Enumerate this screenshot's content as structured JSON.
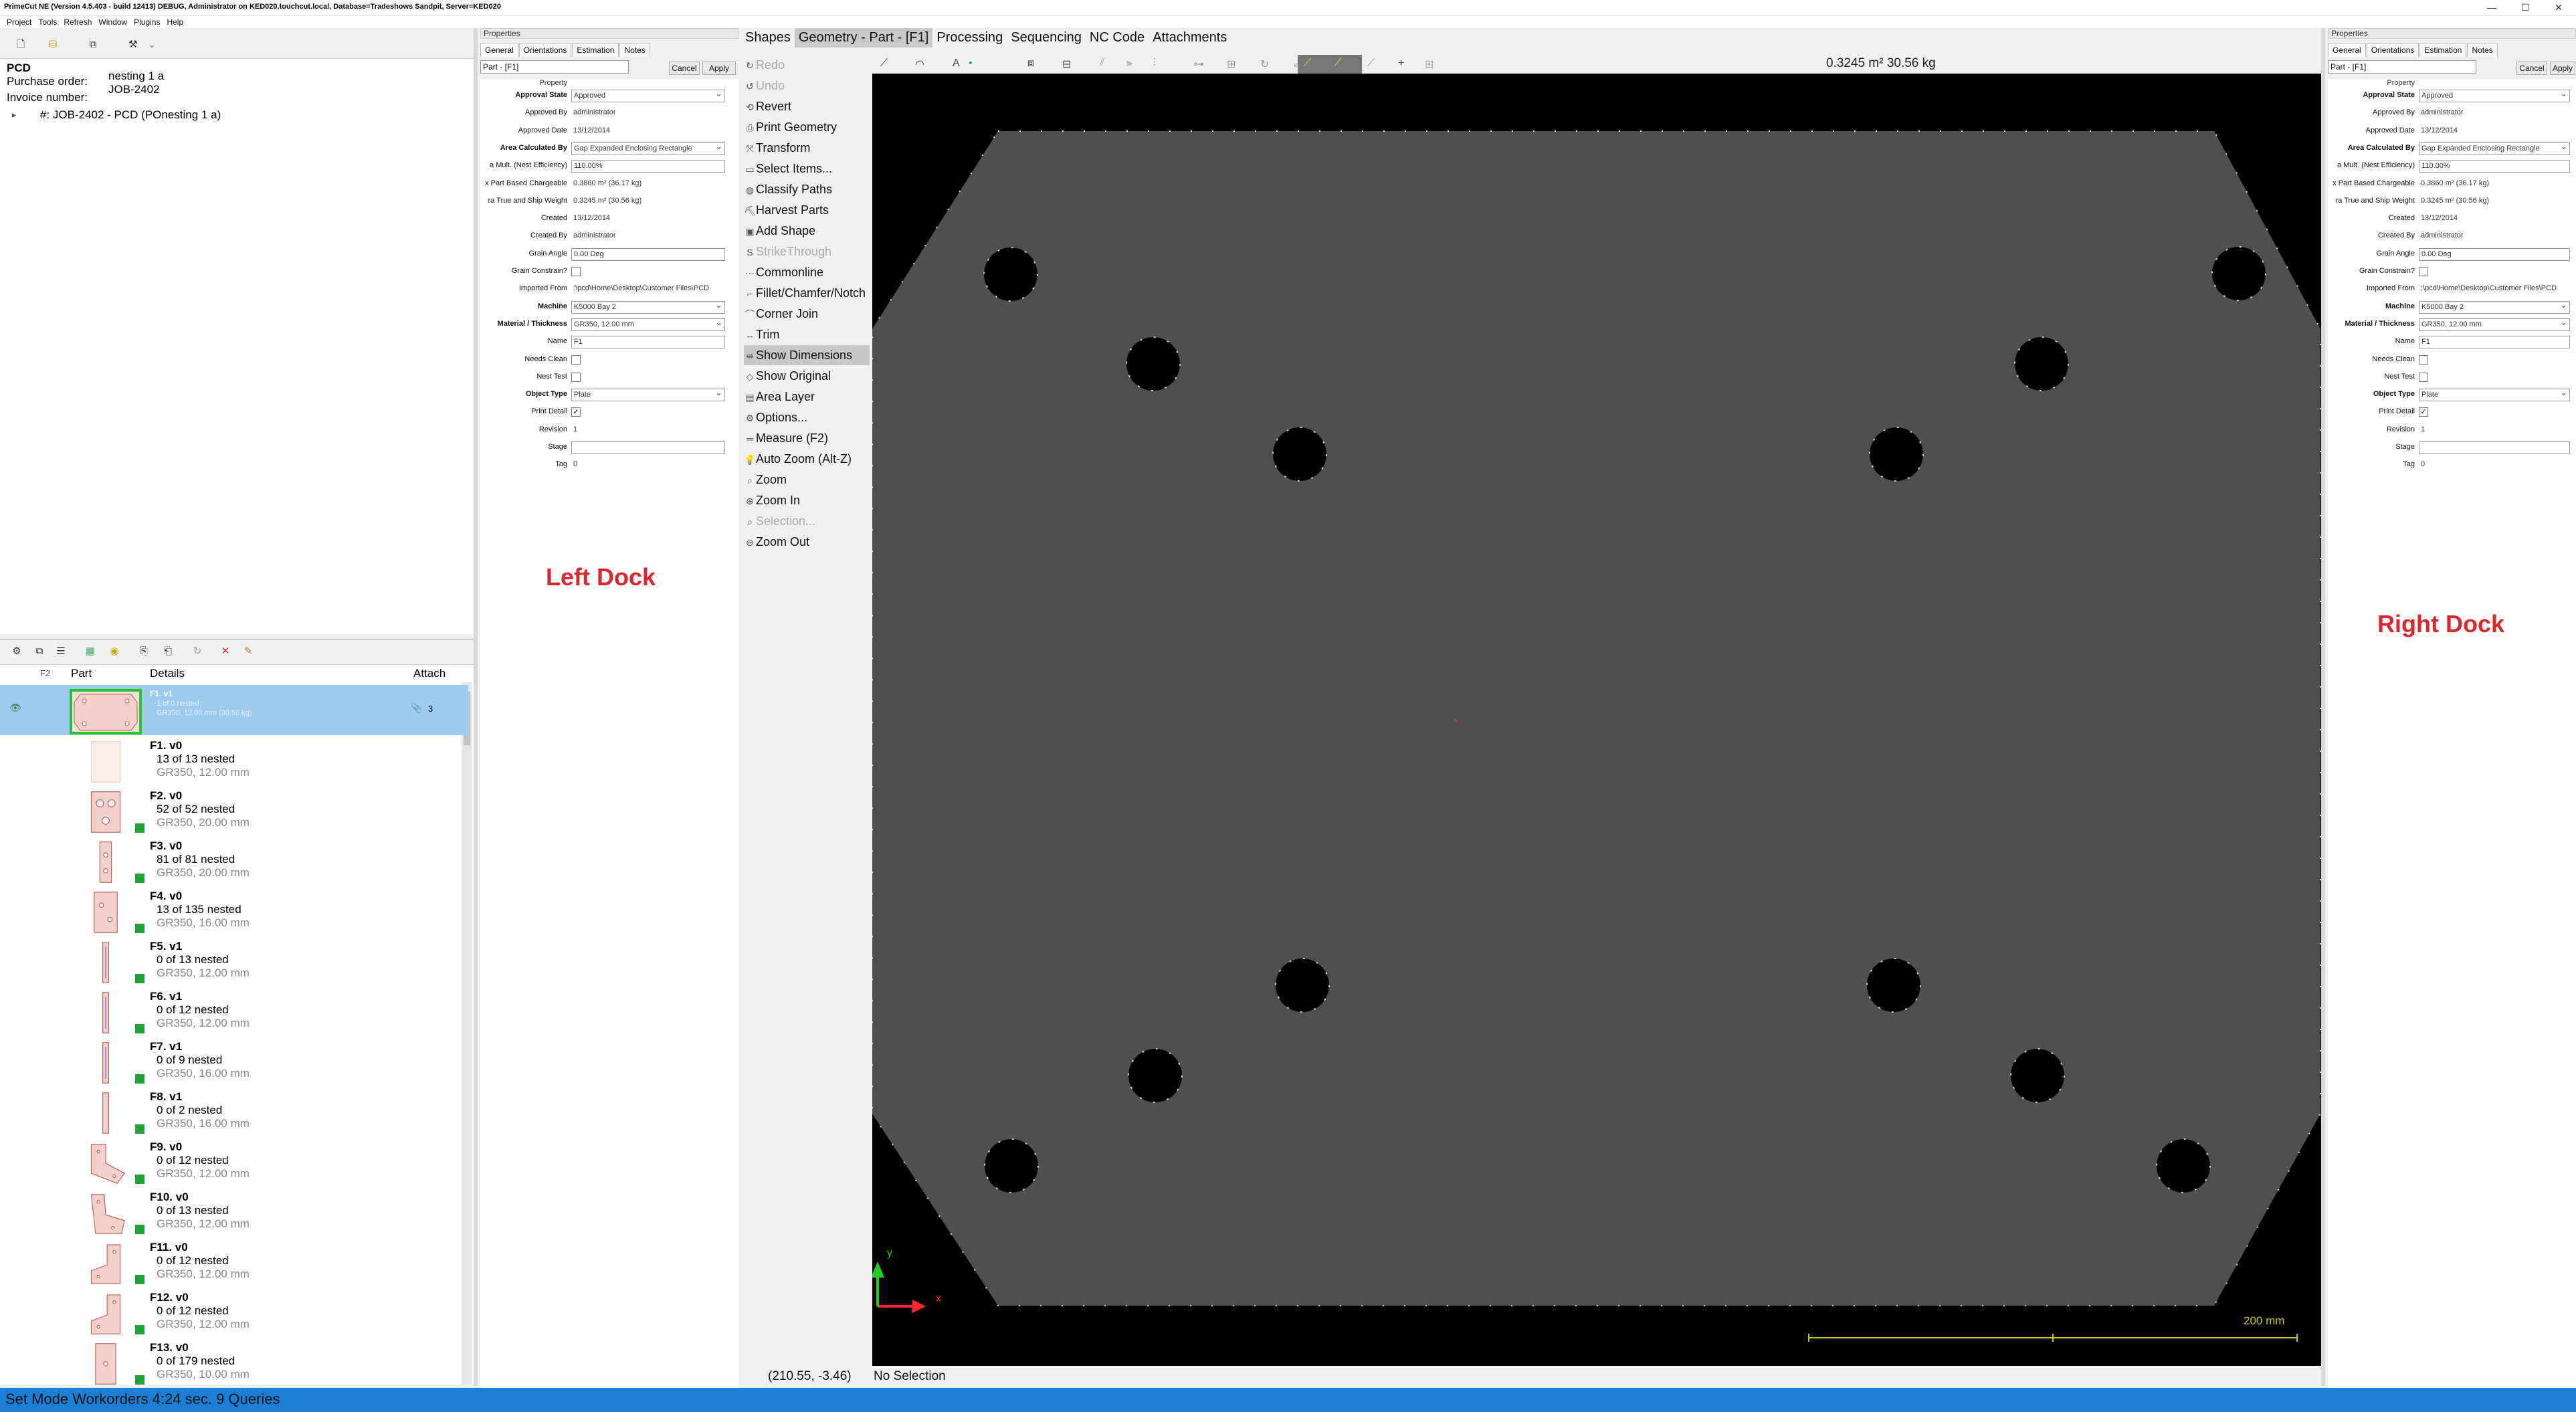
{
  "window": {
    "title": "PrimeCut NE (Version 4.5.403 - build 12413) DEBUG, Administrator on KED020.touchcut.local, Database=Tradeshows Sandpit, Server=KED020",
    "controls": [
      "—",
      "☐",
      "✕"
    ]
  },
  "menu": [
    "Project",
    "Tools",
    "Refresh",
    "Window",
    "Plugins",
    "Help"
  ],
  "job": {
    "customer": "PCD",
    "po_label": "Purchase order:",
    "po_value": "nesting 1 a",
    "invoice_label": "Invoice number:",
    "invoice_value": "JOB-2402",
    "tree_item": "#: JOB-2402 - PCD (POnesting 1 a)"
  },
  "partlist": {
    "headers": {
      "flag": "F2",
      "part": "Part",
      "details": "Details",
      "attach": "Attach"
    },
    "selected": {
      "name": "F1. v1",
      "nest": "1 of 0 nested",
      "mat": "GR350, 12.00 mm (30.56 kg)",
      "attach": "3"
    },
    "rows": [
      {
        "name": "F1. v0",
        "nest": "13 of 13 nested",
        "mat": "GR350, 12.00 mm"
      },
      {
        "name": "F2. v0",
        "nest": "52 of 52 nested",
        "mat": "GR350, 20.00 mm"
      },
      {
        "name": "F3. v0",
        "nest": "81 of 81 nested",
        "mat": "GR350, 20.00 mm"
      },
      {
        "name": "F4. v0",
        "nest": "13 of 135 nested",
        "mat": "GR350, 16.00 mm"
      },
      {
        "name": "F5. v1",
        "nest": "0 of 13 nested",
        "mat": "GR350, 12.00 mm"
      },
      {
        "name": "F6. v1",
        "nest": "0 of 12 nested",
        "mat": "GR350, 12.00 mm"
      },
      {
        "name": "F7. v1",
        "nest": "0 of 9 nested",
        "mat": "GR350, 16.00 mm"
      },
      {
        "name": "F8. v1",
        "nest": "0 of 2 nested",
        "mat": "GR350, 16.00 mm"
      },
      {
        "name": "F9. v0",
        "nest": "0 of 12 nested",
        "mat": "GR350, 12.00 mm"
      },
      {
        "name": "F10. v0",
        "nest": "0 of 13 nested",
        "mat": "GR350, 12.00 mm"
      },
      {
        "name": "F11. v0",
        "nest": "0 of 12 nested",
        "mat": "GR350, 12.00 mm"
      },
      {
        "name": "F12. v0",
        "nest": "0 of 12 nested",
        "mat": "GR350, 12.00 mm"
      },
      {
        "name": "F13. v0",
        "nest": "0 of 179 nested",
        "mat": "GR350, 10.00 mm"
      }
    ]
  },
  "properties": {
    "title": "Properties",
    "tabs": [
      "General",
      "Orientations",
      "Estimation",
      "Notes"
    ],
    "selector": "Part - [F1]",
    "cancel": "Cancel",
    "apply": "Apply",
    "header": "Property",
    "rows": [
      {
        "label": "Approval State",
        "bold": true,
        "value": "Approved",
        "kind": "dd"
      },
      {
        "label": "Approved By",
        "value": "administrator",
        "kind": "text"
      },
      {
        "label": "Approved Date",
        "value": "13/12/2014",
        "kind": "text"
      },
      {
        "label": "Area Calculated By",
        "bold": true,
        "value": "Gap Expanded Enclosing Rectangle",
        "kind": "dd"
      },
      {
        "label": "a Mult. (Nest Efficiency)",
        "value": "110.00%",
        "kind": "box"
      },
      {
        "label": "x Part Based Chargeable",
        "value": "0.3860 m² (36.17 kg)",
        "kind": "text"
      },
      {
        "label": "ra True and Ship Weight",
        "value": "0.3245 m² (30.56 kg)",
        "kind": "text"
      },
      {
        "label": "Created",
        "value": "13/12/2014",
        "kind": "text"
      },
      {
        "label": "Created By",
        "value": "administrator",
        "kind": "text"
      },
      {
        "label": "Grain Angle",
        "value": "0.00 Deg",
        "kind": "box"
      },
      {
        "label": "Grain Constrain?",
        "value": "",
        "kind": "cb"
      },
      {
        "label": "Imported From",
        "value": ":\\pcd\\Home\\Desktop\\Customer Files\\PCD",
        "kind": "text"
      },
      {
        "label": "Machine",
        "bold": true,
        "value": "K5000 Bay 2",
        "kind": "dd"
      },
      {
        "label": "Material / Thickness",
        "bold": true,
        "value": "GR350, 12.00 mm",
        "kind": "dd"
      },
      {
        "label": "Name",
        "value": "F1",
        "kind": "box"
      },
      {
        "label": "Needs Clean",
        "value": "",
        "kind": "cb"
      },
      {
        "label": "Nest Test",
        "value": "",
        "kind": "cb"
      },
      {
        "label": "Object Type",
        "bold": true,
        "value": "Plate",
        "kind": "dd"
      },
      {
        "label": "Print Detail",
        "value": "✓",
        "kind": "cb"
      },
      {
        "label": "Revision",
        "value": "1",
        "kind": "text"
      },
      {
        "label": "Stage",
        "value": "",
        "kind": "box"
      },
      {
        "label": "Tag",
        "value": "0",
        "kind": "text"
      }
    ]
  },
  "dock_left": "Left Dock",
  "dock_right": "Right Dock",
  "tabs": [
    "Shapes",
    "Geometry - Part - [F1]",
    "Processing",
    "Sequencing",
    "NC Code",
    "Attachments"
  ],
  "commands": [
    {
      "label": "Redo",
      "icon": "↻",
      "state": "dis"
    },
    {
      "label": "Undo",
      "icon": "↺",
      "state": "dis"
    },
    {
      "label": "Revert",
      "icon": "⟲",
      "state": ""
    },
    {
      "label": "Print Geometry",
      "icon": "⎙",
      "state": ""
    },
    {
      "label": "Transform",
      "icon": "⤧",
      "state": ""
    },
    {
      "label": "Select Items...",
      "icon": "▭",
      "state": ""
    },
    {
      "label": "Classify Paths",
      "icon": "◍",
      "state": ""
    },
    {
      "label": "Harvest Parts",
      "icon": "⛏",
      "state": ""
    },
    {
      "label": "Add Shape",
      "icon": "▣",
      "state": ""
    },
    {
      "label": "StrikeThrough",
      "icon": "S",
      "state": "dis"
    },
    {
      "label": "Commonline",
      "icon": "⋯",
      "state": ""
    },
    {
      "label": "Fillet/Chamfer/Notch",
      "icon": "⌐",
      "state": ""
    },
    {
      "label": "Corner Join",
      "icon": "⌒",
      "state": ""
    },
    {
      "label": "Trim",
      "icon": "↔",
      "state": ""
    },
    {
      "label": "Show Dimensions",
      "icon": "⇹",
      "state": "on"
    },
    {
      "label": "Show Original",
      "icon": "◇",
      "state": ""
    },
    {
      "label": "Area Layer",
      "icon": "▤",
      "state": ""
    },
    {
      "label": "Options...",
      "icon": "⚙",
      "state": ""
    },
    {
      "label": "Measure (F2)",
      "icon": "═",
      "state": ""
    },
    {
      "label": "Auto Zoom (Alt-Z)",
      "icon": "💡",
      "state": ""
    },
    {
      "label": "Zoom",
      "icon": "⌕",
      "state": ""
    },
    {
      "label": "Zoom In",
      "icon": "⊕",
      "state": ""
    },
    {
      "label": "Selection...",
      "icon": "⌕",
      "state": "dis"
    },
    {
      "label": "Zoom Out",
      "icon": "⊖",
      "state": ""
    }
  ],
  "canvas": {
    "area_readout": "0.3245 m²  30.56 kg",
    "scale_label": "200 mm",
    "axis_x": "x",
    "axis_y": "y",
    "accent": "#ff2a2a",
    "part_fill": "#4f4f4f"
  },
  "status": {
    "coords": "(210.55, -3.46)",
    "selection": "No Selection"
  },
  "bottom": "Set Mode Workorders 4:24 sec. 9 Queries"
}
